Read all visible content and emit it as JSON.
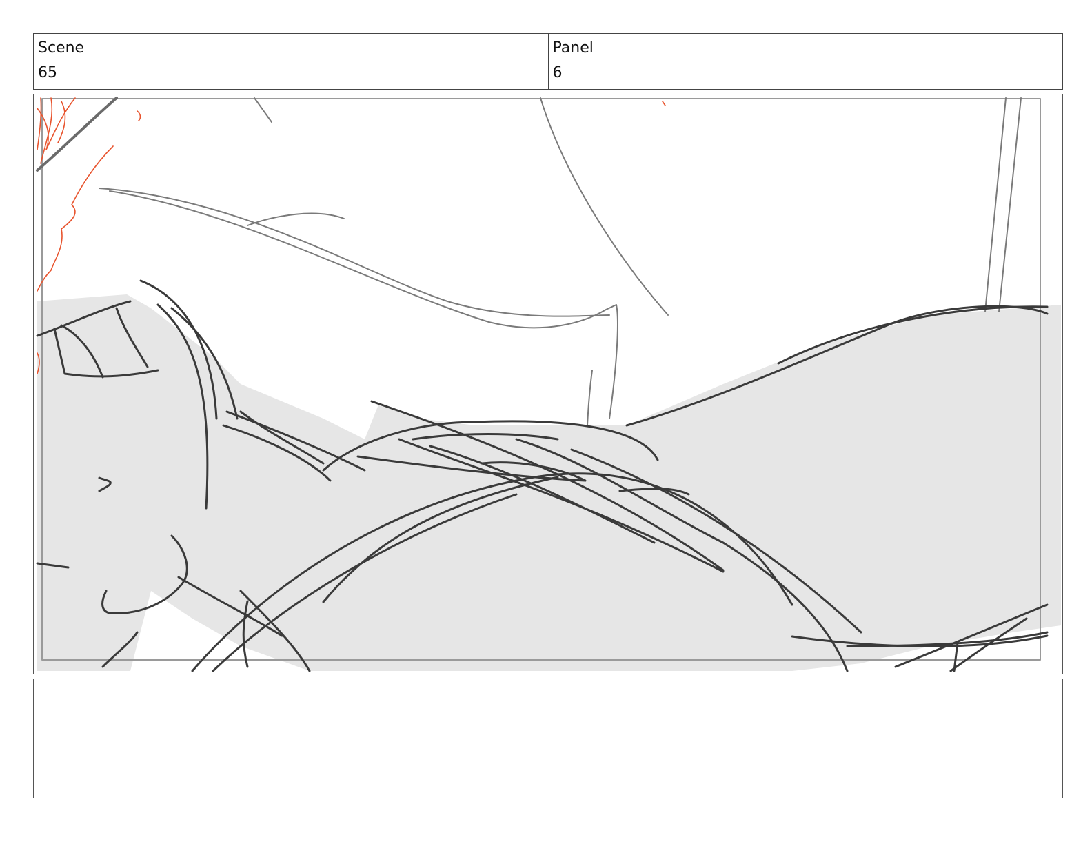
{
  "header": {
    "scene_label": "Scene",
    "scene_value": "65",
    "panel_label": "Panel",
    "panel_value": "6"
  },
  "notes": {
    "text": ""
  }
}
